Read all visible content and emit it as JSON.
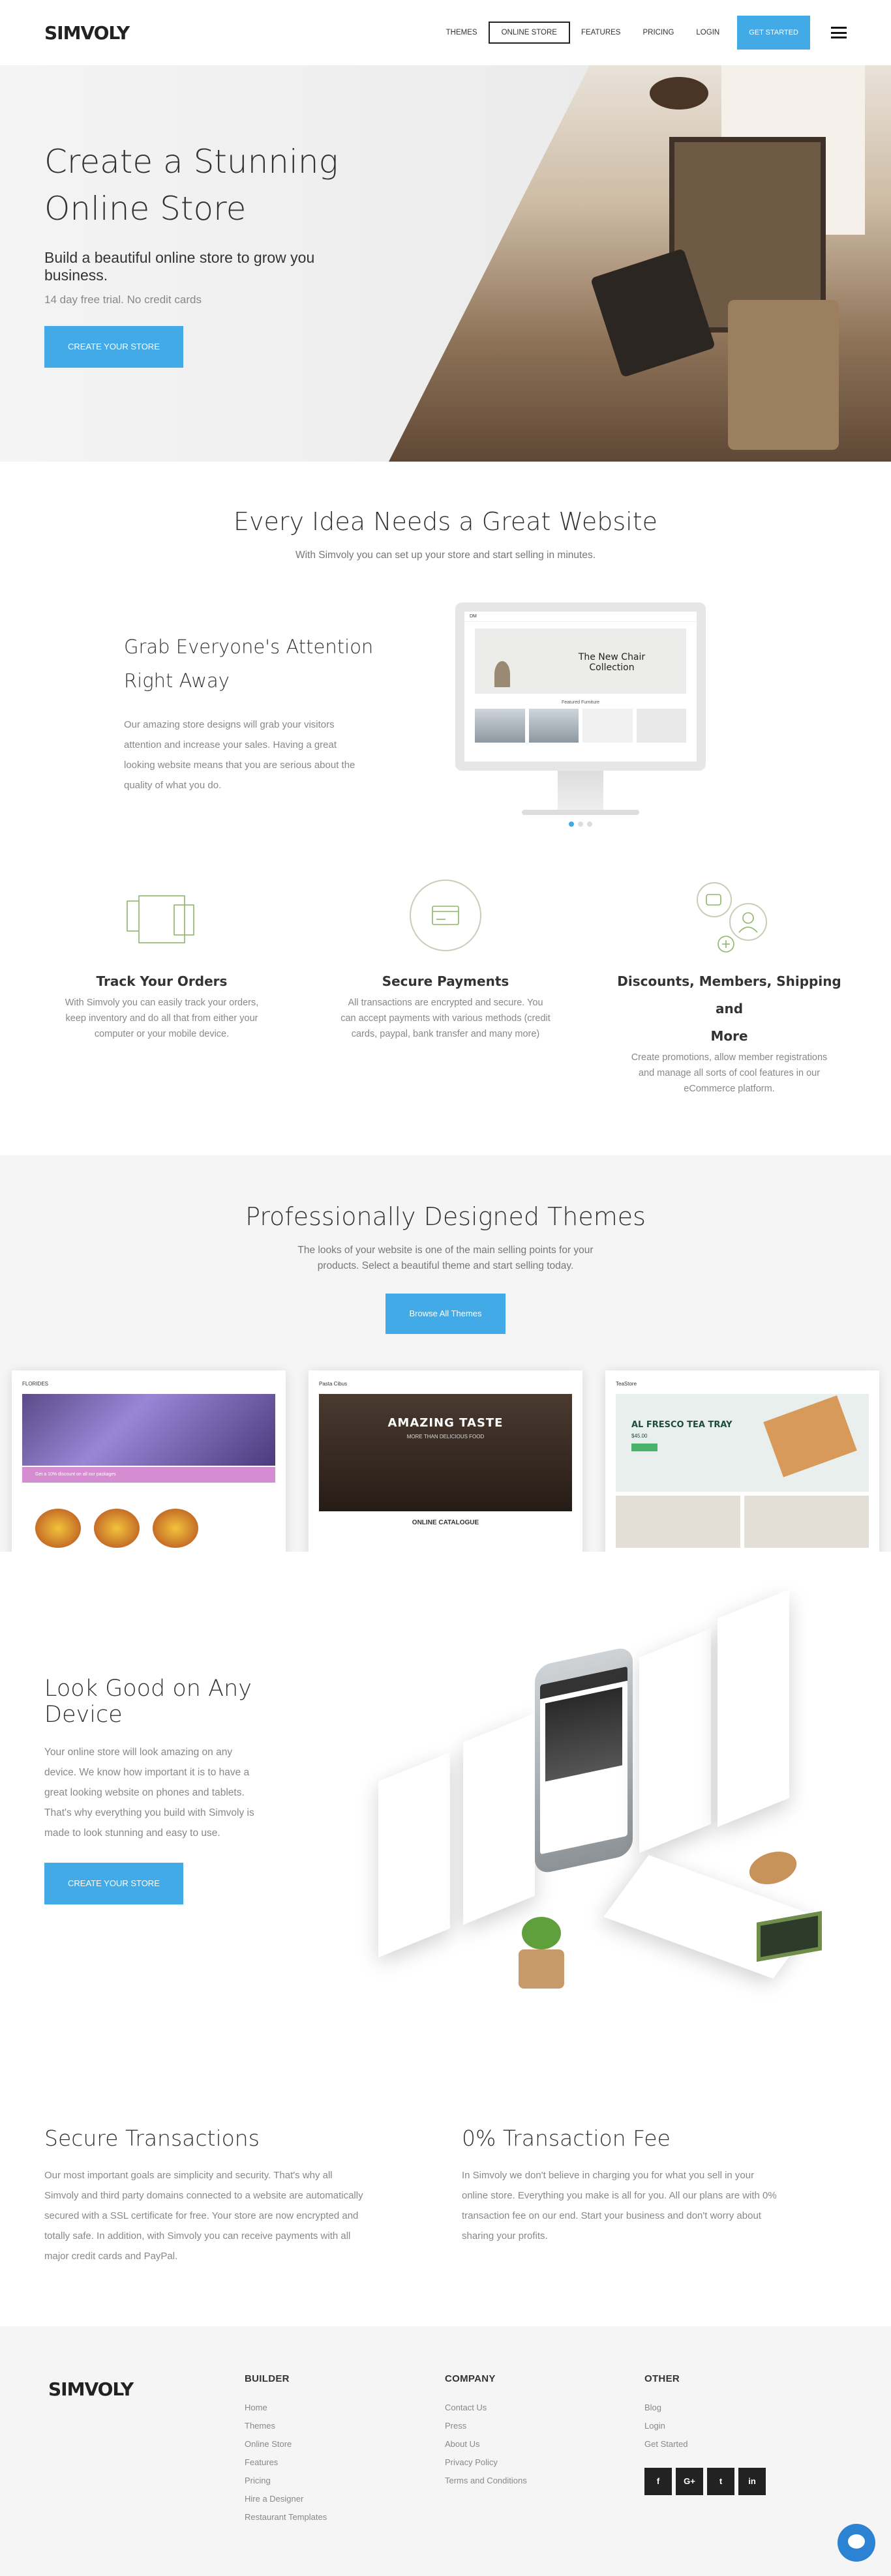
{
  "header": {
    "logo": "SIMVOLY",
    "nav": [
      "THEMES",
      "ONLINE STORE",
      "FEATURES",
      "PRICING",
      "LOGIN"
    ],
    "active_nav": "ONLINE STORE",
    "cta": "GET STARTED"
  },
  "hero": {
    "title": "Create a Stunning\nOnline Store",
    "subtitle": "Build a beautiful online store to grow you business.",
    "note": "14 day free trial. No credit cards",
    "button": "CREATE YOUR STORE"
  },
  "ideas": {
    "title": "Every Idea Needs a Great Website",
    "lead": "With Simvoly you can set up your store and start selling in minutes.",
    "grab_title": "Grab Everyone's Attention\nRight Away",
    "grab_body": "Our amazing store designs will grab your visitors attention and increase your sales. Having a great looking website means that you are serious about the quality of what you do.",
    "mockup": {
      "brand": "DM",
      "hero_text": "The New Chair\nCollection",
      "featured": "Featured Furniture"
    },
    "slider_active": 0,
    "slider_count": 3
  },
  "features": [
    {
      "icon": "squares-icon",
      "title": "Track Your Orders",
      "body": "With Simvoly you can easily track your orders, keep inventory and do all that from either your computer or your mobile device."
    },
    {
      "icon": "credit-card-icon",
      "title": "Secure Payments",
      "body": "All transactions are encrypted and secure. You can accept payments with various methods (credit cards, paypal, bank transfer and many more)"
    },
    {
      "icon": "discount-members-icon",
      "title": "Discounts, Members, Shipping and\nMore",
      "body": "Create promotions, allow member registrations and manage all sorts of cool features in our eCommerce platform."
    }
  ],
  "themes": {
    "title": "Professionally Designed Themes",
    "lead": "The looks of your website is one of the main selling points for your products. Select a beautiful theme and start selling today.",
    "button": "Browse All Themes",
    "cards": [
      {
        "brand": "FLORIDES",
        "banner": "Get a 10% discount on all our packages"
      },
      {
        "brand": "Pasta Cibus",
        "headline": "AMAZING TASTE",
        "sub": "MORE THAN DELICIOUS FOOD",
        "section": "ONLINE CATALOGUE"
      },
      {
        "brand": "TeaStore",
        "headline": "AL FRESCO TEA TRAY",
        "price": "$45.00"
      }
    ]
  },
  "device": {
    "title": "Look Good on Any Device",
    "body": "Your online store will look amazing on any device. We know how important it is to have a great looking website on phones and tablets. That's why everything you build with Simvoly is made to look stunning and easy to use.",
    "button": "CREATE YOUR STORE"
  },
  "secure": {
    "title": "Secure Transactions",
    "body": "Our most important goals are simplicity and security. That's why all Simvoly and third party domains connected to a website are automatically secured with a SSL certificate for free. Your store are now encrypted and totally safe. In addition, with Simvoly you can receive payments with all major credit cards and PayPal."
  },
  "fee": {
    "title": "0% Transaction Fee",
    "body": "In Simvoly we don't believe in charging you for what you sell in your online store. Everything you make is all for you. All our plans are with 0% transaction fee on our end. Start your business and don't worry about sharing your profits."
  },
  "footer": {
    "logo": "SIMVOLY",
    "builder": {
      "title": "BUILDER",
      "links": [
        "Home",
        "Themes",
        "Online Store",
        "Features",
        "Pricing",
        "Hire a Designer",
        "Restaurant Templates"
      ]
    },
    "company": {
      "title": "COMPANY",
      "links": [
        "Contact Us",
        "Press",
        "About Us",
        "Privacy Policy",
        "Terms and Conditions"
      ]
    },
    "other": {
      "title": "OTHER",
      "links": [
        "Blog",
        "Login",
        "Get Started"
      ]
    },
    "social": [
      "f",
      "G+",
      "t",
      "in"
    ]
  },
  "colors": {
    "accent": "#42aae7",
    "dark": "#222222",
    "muted": "#888888",
    "footer_bg": "#f5f5f5"
  }
}
